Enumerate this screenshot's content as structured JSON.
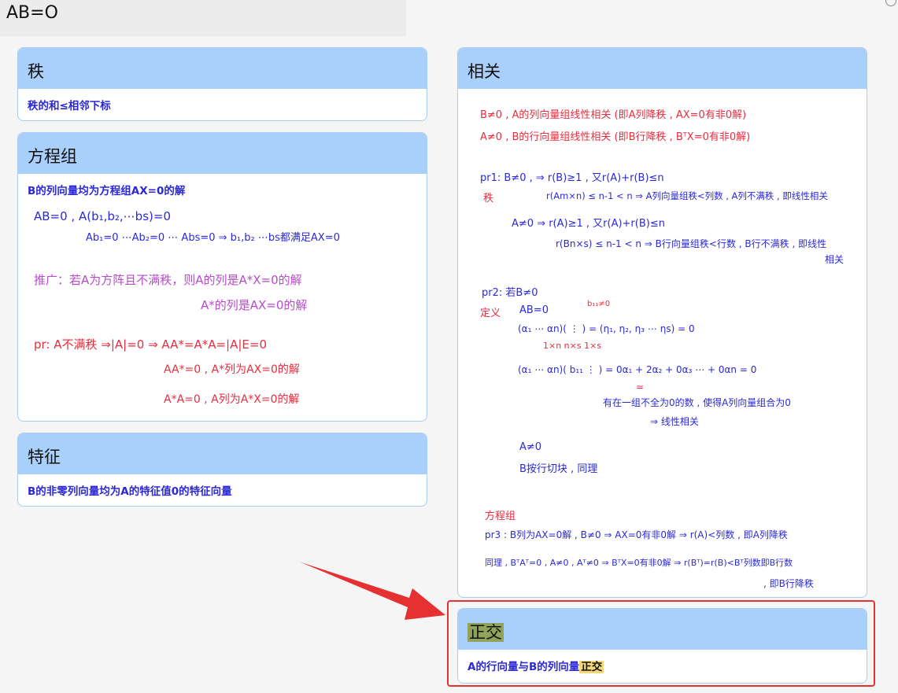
{
  "page": {
    "title": "AB=O"
  },
  "rank": {
    "header": "秩",
    "note": "秩的和≤相邻下标"
  },
  "equations": {
    "header": "方程组",
    "note": "B的列向量均为方程组AX=0的解",
    "hw": [
      "AB=0 , A(b₁,b₂,⋯bs)=0",
      "Ab₁=0 ⋯Ab₂=0 ⋯ Abs=0 ⇒ b₁,b₂ ⋯bs都满足AX=0",
      "推广：若A为方阵且不满秩，则A的列是A*X=0的解",
      "A*的列是AX=0的解",
      "pr: A不满秩 ⇒|A|=0 ⇒ AA*=A*A=|A|E=0",
      "AA*=0 , A*列为AX=0的解",
      "A*A=0 , A列为A*X=0的解"
    ]
  },
  "feature": {
    "header": "特征",
    "note": "B的非零列向量均为A的特征值0的特征向量"
  },
  "correlation": {
    "header": "相关",
    "hw": [
      "B≠0 , A的列向量组线性相关 (即A列降秩 , AX=0有非0解)",
      "A≠0 , B的行向量组线性相关 (即B行降秩 , BᵀX=0有非0解)",
      "pr1:  B≠0 , ⇒ r(B)≥1 , 又r(A)+r(B)≤n",
      "秩",
      "r(Am×n) ≤ n-1 < n ⇒ A列向量组秩<列数 , A列不满秩 , 即线性相关",
      "A≠0 ⇒ r(A)≥1 , 又r(A)+r(B)≤n",
      "r(Bn×s) ≤ n-1 < n ⇒ B行向量组秩<行数 , B行不满秩 , 即线性",
      "相关",
      "pr2:  若B≠0",
      "定义",
      "AB=0",
      "b₁₁≠0",
      "(α₁ ⋯ αn)( ⋮ ) = (η₁, η₂, η₃ ⋯ ηs) = 0",
      "1×n  n×s        1×s",
      "(α₁ ⋯ αn)( b₁₁ ⋮ ) = 0α₁ + 2α₂ + 0α₃ ⋯ + 0αn = 0",
      "=",
      "有在一组不全为0的数 , 使得A列向量组合为0",
      "⇒ 线性相关",
      "A≠0",
      "B按行切块 , 同理",
      "方程组",
      "pr3 : B列为AX=0解 , B≠0 ⇒ AX=0有非0解 ⇒ r(A)<列数 , 即A列降秩",
      "同理 , BᵀAᵀ=0 , A≠0 , Aᵀ≠0 ⇒ BᵀX=0有非0解 ⇒ r(Bᵀ)=r(B)<Bᵀ列数即B行数",
      ", 即B行降秩"
    ]
  },
  "orthogonal": {
    "header": "正交",
    "note_prefix": "A的行向量与B的列向量",
    "note_highlight": "正交"
  },
  "colors": {
    "card_header": "#a9d0fb",
    "card_border": "#a9cdf0",
    "note_text": "#2b28d6",
    "handwriting_blue": "#2a2ad8",
    "handwriting_red": "#e82d3e",
    "handwriting_purple": "#b84bcc",
    "arrow": "#e53131"
  }
}
